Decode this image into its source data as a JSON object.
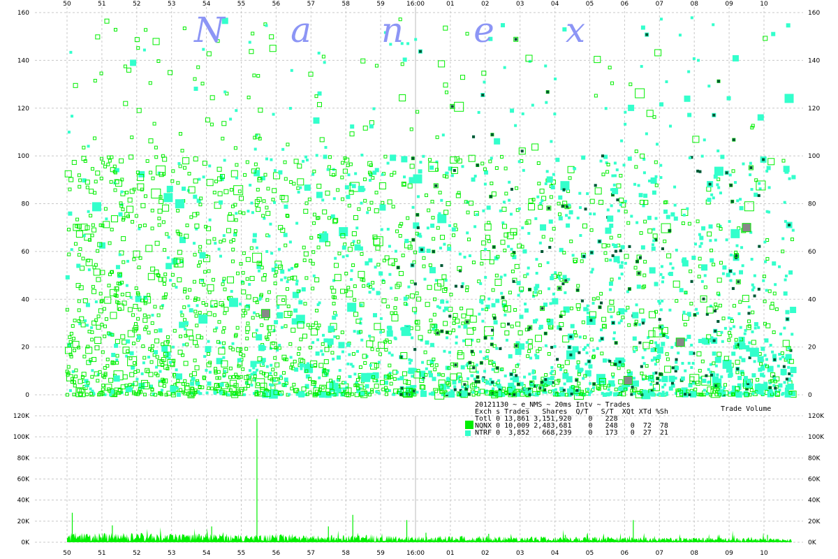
{
  "brand_letters": [
    "N",
    "a",
    "n",
    "e",
    "x"
  ],
  "colors": {
    "background": "#ffffff",
    "grid": "#c8c8c8",
    "separator": "#bbbbbb",
    "nqnx": "#00ee00",
    "ntrf": "#33ffcc",
    "cross": "#005533",
    "grey": "#888888",
    "brand": "#8c95f5"
  },
  "chart_data": [
    {
      "type": "scatter",
      "x_ticks": [
        "50",
        "51",
        "52",
        "53",
        "54",
        "55",
        "56",
        "57",
        "58",
        "59",
        "16:00",
        "01",
        "02",
        "03",
        "04",
        "05",
        "06",
        "07",
        "08",
        "09",
        "10"
      ],
      "y_ticks": [
        "0",
        "20",
        "40",
        "60",
        "80",
        "100",
        "120",
        "140",
        "160"
      ],
      "ylim": [
        0,
        160
      ],
      "x_domain_seconds": [
        50,
        71
      ],
      "series": [
        {
          "name": "NQNX",
          "color": "#00ee00",
          "style": "hollow-square"
        },
        {
          "name": "NTRF",
          "color": "#33ffcc",
          "style": "filled-square"
        }
      ]
    },
    {
      "type": "area",
      "title": "Trade Volume",
      "x_ticks": [
        "50",
        "51",
        "52",
        "53",
        "54",
        "55",
        "56",
        "57",
        "58",
        "59",
        "16:00",
        "01",
        "02",
        "03",
        "04",
        "05",
        "06",
        "07",
        "08",
        "09",
        "10"
      ],
      "y_ticks": [
        "0K",
        "20K",
        "40K",
        "60K",
        "80K",
        "100K",
        "120K"
      ],
      "ylim": [
        0,
        120000
      ],
      "spikes": [
        {
          "second": 55.45,
          "value": 117000
        },
        {
          "second": 58.2,
          "value": 26000
        },
        {
          "second": 50.15,
          "value": 28000
        },
        {
          "second": 59.75,
          "value": 21000
        },
        {
          "second": 66.25,
          "value": 21000
        },
        {
          "second": 54.15,
          "value": 15000
        },
        {
          "second": 51.3,
          "value": 16000
        },
        {
          "second": 57.5,
          "value": 15000
        },
        {
          "second": 60.3,
          "value": 9000
        },
        {
          "second": 62.1,
          "value": 8000
        },
        {
          "second": 64.3,
          "value": 7000
        },
        {
          "second": 70.1,
          "value": 7000
        }
      ]
    }
  ],
  "stats_panel": {
    "header": "20121130 ~ e_NMS ~ 20ms Intv ~ Trades",
    "columns": "Exch s Trades   Shares  Q/T   S/T  XQt XTd %Sh",
    "rows": [
      {
        "text": "Totl 0 13,861 3,151,920    0   228",
        "swatch": ""
      },
      {
        "text": "NQNX 0 10,009 2,483,681    0   248   0  72  78",
        "swatch": "#00ee00"
      },
      {
        "text": "NTRF 0  3,852   668,239    0   173   0  27  21",
        "swatch": "#33ffcc"
      }
    ]
  }
}
